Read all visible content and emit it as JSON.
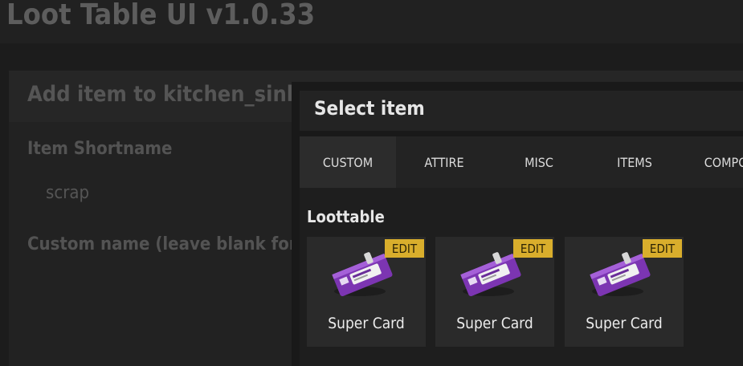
{
  "app": {
    "title": "Loot Table UI v1.0.33"
  },
  "background_panel": {
    "heading": "Add item to kitchen_sink",
    "shortname_label": "Item Shortname",
    "shortname_value": "scrap",
    "custom_name_label": "Custom name (leave blank for d"
  },
  "modal": {
    "title": "Select item",
    "tabs": [
      {
        "label": "CUSTOM",
        "active": true
      },
      {
        "label": "ATTIRE",
        "active": false
      },
      {
        "label": "MISC",
        "active": false
      },
      {
        "label": "ITEMS",
        "active": false
      },
      {
        "label": "COMPON",
        "active": false
      }
    ],
    "section_title": "Loottable",
    "items": [
      {
        "name": "Super Card",
        "badge": "EDIT",
        "icon": "keycard-icon"
      },
      {
        "name": "Super Card",
        "badge": "EDIT",
        "icon": "keycard-icon"
      },
      {
        "name": "Super Card",
        "badge": "EDIT",
        "icon": "keycard-icon"
      }
    ]
  },
  "colors": {
    "accent_badge": "#d9ae2c",
    "card_purple": "#8a3fc0",
    "card_body": "#ffffff"
  }
}
